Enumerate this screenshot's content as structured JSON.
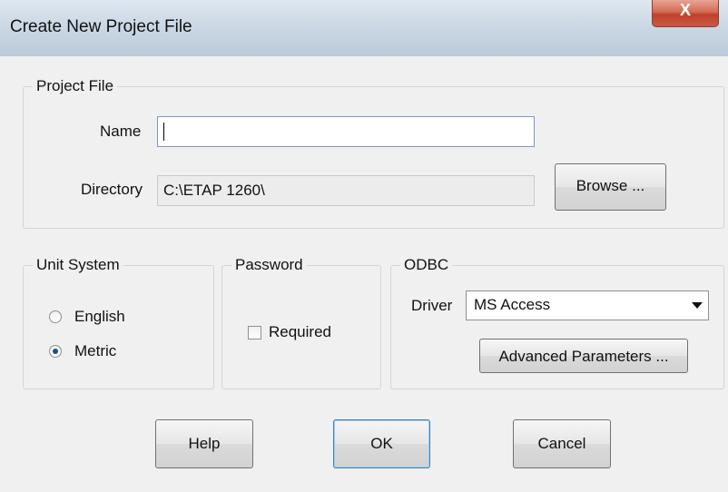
{
  "window": {
    "title": "Create New Project File",
    "close_glyph": "X"
  },
  "project_file": {
    "legend": "Project File",
    "name_label": "Name",
    "name_value": "",
    "directory_label": "Directory",
    "directory_value": "C:\\ETAP 1260\\",
    "browse_label": "Browse ..."
  },
  "unit_system": {
    "legend": "Unit System",
    "options": [
      {
        "label": "English",
        "selected": false
      },
      {
        "label": "Metric",
        "selected": true
      }
    ]
  },
  "password": {
    "legend": "Password",
    "required_label": "Required",
    "required_checked": false
  },
  "odbc": {
    "legend": "ODBC",
    "driver_label": "Driver",
    "driver_value": "MS Access",
    "advanced_label": "Advanced Parameters ..."
  },
  "footer": {
    "help_label": "Help",
    "ok_label": "OK",
    "cancel_label": "Cancel"
  }
}
